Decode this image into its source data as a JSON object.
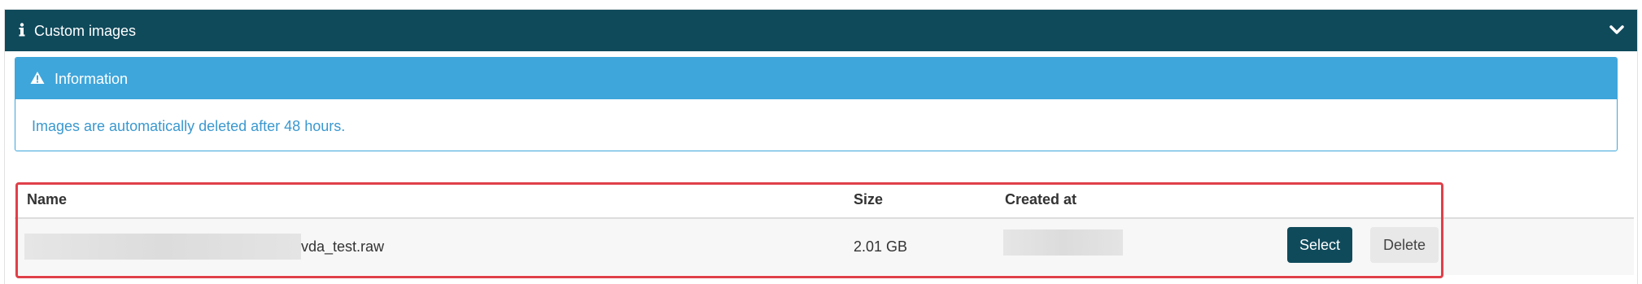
{
  "panel": {
    "title": "Custom images",
    "info_icon": "info-icon",
    "collapse_icon": "chevron-down-icon"
  },
  "alert": {
    "icon": "warning-icon",
    "title": "Information",
    "message": "Images are automatically deleted after 48 hours."
  },
  "table": {
    "columns": [
      "Name",
      "Size",
      "Created at"
    ],
    "rows": [
      {
        "name_suffix": "vda_test.raw",
        "size": "2.01 GB",
        "select_label": "Select",
        "delete_label": "Delete"
      }
    ]
  },
  "colors": {
    "header_bg": "#0f4a5b",
    "alert_bg": "#3ea6db",
    "highlight": "#e0404a"
  }
}
